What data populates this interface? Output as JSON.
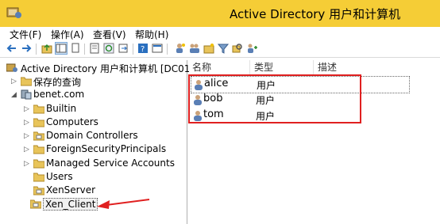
{
  "window": {
    "title": "Active Directory 用户和计算机"
  },
  "menu": [
    "文件(F)",
    "操作(A)",
    "查看(V)",
    "帮助(H)"
  ],
  "toolbar": {
    "icons": [
      "back-icon",
      "forward-icon",
      "up-icon",
      "show-tree-icon",
      "copy-icon",
      "delete-icon",
      "properties-icon",
      "refresh-icon",
      "export-icon",
      "help-icon",
      "console-icon",
      "add-user-icon",
      "add-group-icon",
      "add-ou-icon",
      "filter-icon",
      "find-icon",
      "add-to-group-icon"
    ]
  },
  "tree": {
    "root": "Active Directory 用户和计算机 [DC01",
    "saved_queries": "保存的查询",
    "domain": "benet.com",
    "children": [
      "Builtin",
      "Computers",
      "Domain Controllers",
      "ForeignSecurityPrincipals",
      "Managed Service Accounts",
      "Users",
      "XenServer",
      "Xen_Client"
    ],
    "selected": "Xen_Client"
  },
  "list": {
    "columns": [
      "名称",
      "类型",
      "描述"
    ],
    "rows": [
      {
        "name": "alice",
        "type": "用户"
      },
      {
        "name": "bob",
        "type": "用户"
      },
      {
        "name": "tom",
        "type": "用户"
      }
    ]
  },
  "colors": {
    "titlebar": "#f5cd36",
    "highlight": "#e02020",
    "arrow": "#e02020"
  }
}
